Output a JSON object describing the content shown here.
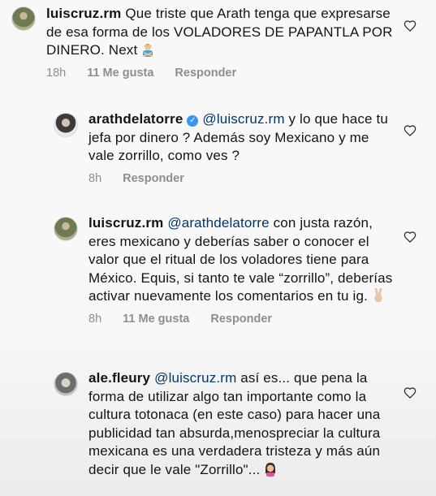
{
  "comments": [
    {
      "username": "luiscruz.rm",
      "verified": false,
      "segments": [
        {
          "type": "text",
          "text": "Que triste que Arath tenga que expresarse de esa forma de los VOLADORES DE PAPANTLA POR DINERO. Next"
        }
      ],
      "emoji": "person-gesturing-no-emoji",
      "time": "18h",
      "likes": "11 Me gusta",
      "reply": "Responder",
      "like_icon": "heart-icon"
    },
    {
      "username": "arathdelatorre",
      "verified": true,
      "verified_icon": "verified-badge-icon",
      "segments": [
        {
          "type": "mention",
          "text": "@luiscruz.rm"
        },
        {
          "type": "text",
          "text": " y lo que hace tu jefa por dinero ? Además soy Mexicano y me vale zorrillo, como ves ?"
        }
      ],
      "time": "8h",
      "reply": "Responder",
      "like_icon": "heart-icon"
    },
    {
      "username": "luiscruz.rm",
      "verified": false,
      "segments": [
        {
          "type": "mention",
          "text": "@arathdelatorre"
        },
        {
          "type": "text",
          "text": " con justa razón, eres mexicano y deberías saber o conocer el valor que el ritual de los voladores tiene para México. Equis, si tanto te vale “zorrillo”, deberías activar nuevamente los comentarios en tu ig."
        }
      ],
      "emoji": "victory-hand-emoji",
      "time": "8h",
      "likes": "11 Me gusta",
      "reply": "Responder",
      "like_icon": "heart-icon"
    },
    {
      "username": "ale.fleury",
      "verified": false,
      "segments": [
        {
          "type": "mention",
          "text": "@luiscruz.rm"
        },
        {
          "type": "text",
          "text": " así es... que pena la forma de utilizar algo tan importante como la cultura totonaca (en este caso) para hacer una publicidad tan absurda,menospreciar la cultura mexicana es una verdadera tristeza y más aún decir que le vale \"Zorrillo\"..."
        }
      ],
      "emoji": "woman-facepalming-emoji",
      "like_icon": "heart-icon"
    }
  ],
  "colors": {
    "text": "#141414",
    "mention": "#00376b",
    "meta": "#8e8e8e",
    "verified": "#3897f0"
  }
}
